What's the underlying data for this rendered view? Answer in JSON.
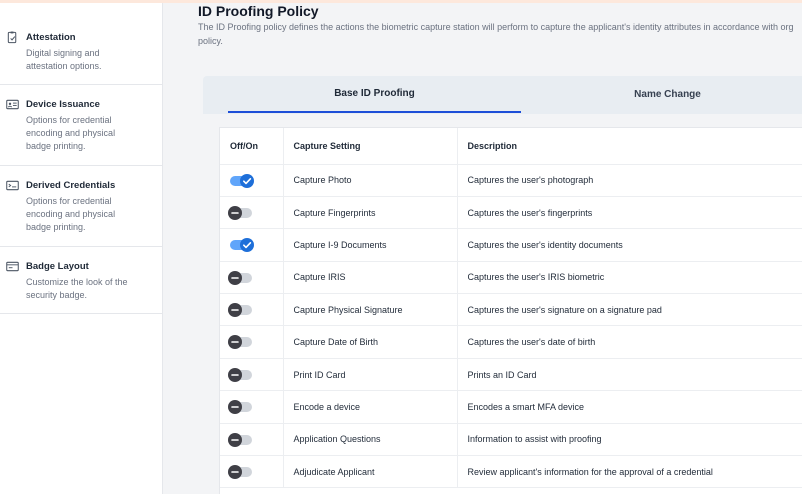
{
  "sidebar": {
    "items": [
      {
        "title": "Attestation",
        "desc": [
          "Digital signing and",
          "attestation options."
        ],
        "icon": "attestation-icon"
      },
      {
        "title": "Device Issuance",
        "desc": [
          "Options for credential",
          "encoding and physical",
          "badge printing."
        ],
        "icon": "id-card-icon"
      },
      {
        "title": "Derived Credentials",
        "desc": [
          "Options for credential",
          "encoding and physical",
          "badge printing."
        ],
        "icon": "derived-credential-icon"
      },
      {
        "title": "Badge Layout",
        "desc": [
          "Customize the look of the",
          "security badge."
        ],
        "icon": "badge-layout-icon"
      }
    ]
  },
  "page": {
    "title": "ID Proofing Policy",
    "desc_line1": "The ID Proofing policy defines the actions the biometric capture station will perform to capture the applicant's identity attributes in accordance with org",
    "desc_line2": "policy."
  },
  "tabs": [
    {
      "label": "Base ID Proofing",
      "active": true
    },
    {
      "label": "Name Change",
      "active": false
    }
  ],
  "table": {
    "headers": [
      "Off/On",
      "Capture Setting",
      "Description"
    ],
    "rows": [
      {
        "on": true,
        "setting": "Capture Photo",
        "description": "Captures the user's photograph"
      },
      {
        "on": false,
        "setting": "Capture Fingerprints",
        "description": "Captures the user's fingerprints"
      },
      {
        "on": true,
        "setting": "Capture I-9 Documents",
        "description": "Captures the user's identity documents"
      },
      {
        "on": false,
        "setting": "Capture IRIS",
        "description": "Captures the user's IRIS biometric"
      },
      {
        "on": false,
        "setting": "Capture Physical Signature",
        "description": "Captures the user's signature on a signature pad"
      },
      {
        "on": false,
        "setting": "Capture Date of Birth",
        "description": "Captures the user's date of birth"
      },
      {
        "on": false,
        "setting": "Print ID Card",
        "description": "Prints an ID Card"
      },
      {
        "on": false,
        "setting": "Encode a device",
        "description": "Encodes a smart MFA device"
      },
      {
        "on": false,
        "setting": "Application Questions",
        "description": "Information to assist with proofing"
      },
      {
        "on": false,
        "setting": "Adjudicate Applicant",
        "description": "Review applicant's information for the approval of a credential"
      }
    ]
  },
  "colors": {
    "accent": "#1d4ed8",
    "toggle_on_track": "#60a5fa",
    "toggle_on_knob": "#1e6fd9",
    "toggle_off_track": "#d1d5db",
    "toggle_off_knob": "#3f3f46"
  }
}
